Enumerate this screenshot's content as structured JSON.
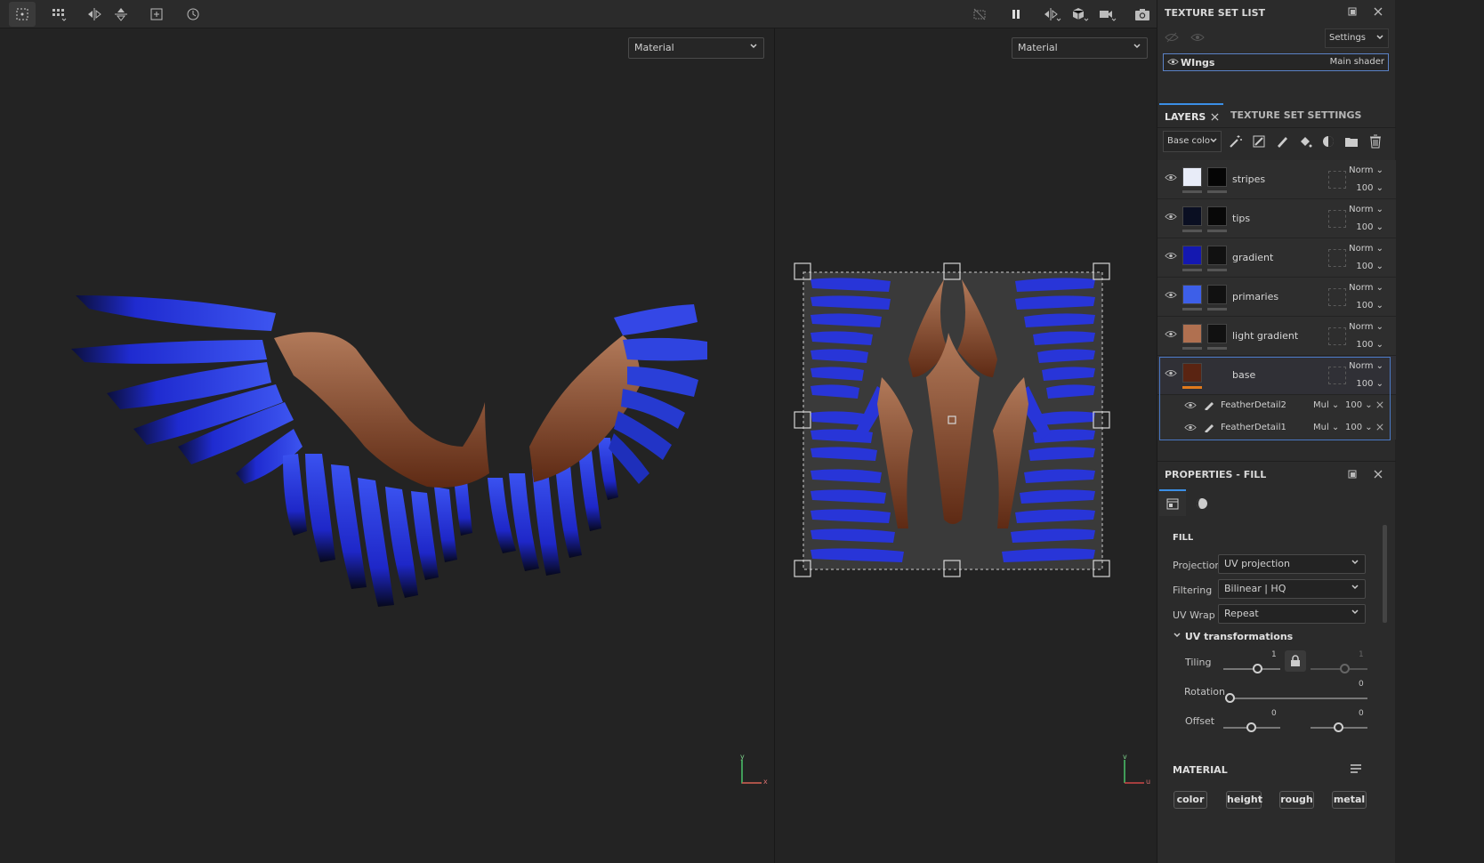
{
  "viewport_left": {
    "mode_select": "Material"
  },
  "viewport_right": {
    "mode_select": "Material"
  },
  "axes": {
    "left_x": "x",
    "left_y": "y",
    "right_u": "u",
    "right_v": "v"
  },
  "texture_set_list": {
    "title": "TEXTURE SET LIST",
    "settings_label": "Settings",
    "row": {
      "name": "WIngs",
      "shader": "Main shader"
    }
  },
  "layers_panel": {
    "tab_layers": "LAYERS",
    "tab_texture_set_settings": "TEXTURE SET SETTINGS",
    "channel_select": "Base colo",
    "layers": [
      {
        "name": "stripes",
        "blend": "Norm",
        "opacity": "100",
        "color": "#e8ecf8",
        "mask": "#050505"
      },
      {
        "name": "tips",
        "blend": "Norm",
        "opacity": "100",
        "color": "#0a0f22",
        "mask": "#080808"
      },
      {
        "name": "gradient",
        "blend": "Norm",
        "opacity": "100",
        "color": "#1418b0",
        "mask": "#111"
      },
      {
        "name": "primaries",
        "blend": "Norm",
        "opacity": "100",
        "color": "#3d5fe8",
        "mask": "#111"
      },
      {
        "name": "light gradient",
        "blend": "Norm",
        "opacity": "100",
        "color": "#b07050",
        "mask": "#111"
      },
      {
        "name": "base",
        "blend": "Norm",
        "opacity": "100",
        "color": "#5a2412"
      }
    ],
    "effects": [
      {
        "name": "FeatherDetail2",
        "blend": "Mul",
        "opacity": "100"
      },
      {
        "name": "FeatherDetail1",
        "blend": "Mul",
        "opacity": "100"
      }
    ]
  },
  "properties": {
    "title": "PROPERTIES - FILL",
    "section_fill": "FILL",
    "projection_label": "Projection",
    "projection_value": "UV projection",
    "filtering_label": "Filtering",
    "filtering_value": "Bilinear | HQ",
    "uvwrap_label": "UV Wrap",
    "uvwrap_value": "Repeat",
    "uv_transformations": "UV transformations",
    "tiling_label": "Tiling",
    "tiling_value_1": "1",
    "tiling_value_2": "1",
    "rotation_label": "Rotation",
    "rotation_value": "0",
    "offset_label": "Offset",
    "offset_value_1": "0",
    "offset_value_2": "0",
    "section_material": "MATERIAL",
    "material_buttons": [
      "color",
      "height",
      "rough",
      "metal"
    ]
  },
  "colors": {
    "accent": "#3b8fe6",
    "selection": "#4a78c4",
    "base_color_bar": "#e07a1c",
    "feather_blue": "#2233d8",
    "feather_brown": "#8a4a2a"
  }
}
